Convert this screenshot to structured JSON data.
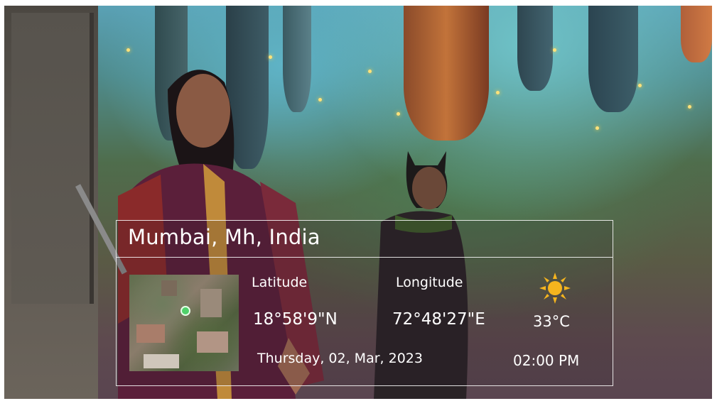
{
  "card": {
    "location": "Mumbai, Mh, India",
    "latitude_label": "Latitude",
    "longitude_label": "Longitude",
    "latitude_value": "18°58'9\"N",
    "longitude_value": "72°48'27\"E",
    "temperature": "33°C",
    "date": "Thursday, 02, Mar, 2023",
    "time": "02:00 PM",
    "weather_icon": "sun-icon",
    "map_icon": "map-pin-icon"
  },
  "colors": {
    "card_border": "#ffffff",
    "text": "#ffffff",
    "sun": "#f6b51e",
    "pin": "#4fd16a"
  }
}
